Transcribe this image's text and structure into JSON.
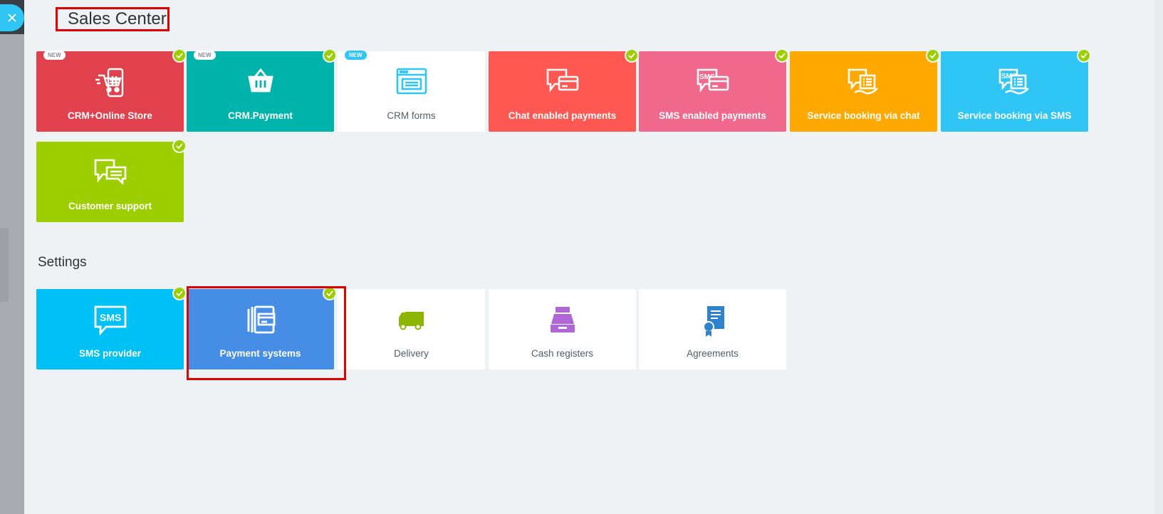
{
  "header": {
    "title": "Sales Center"
  },
  "close_button": {
    "icon": "close-icon"
  },
  "sales_tiles": [
    {
      "label": "CRM+Online Store",
      "color": "#e0414c",
      "badge": "NEW",
      "checked": true,
      "icon": "cart-phone-icon"
    },
    {
      "label": "CRM.Payment",
      "color": "#00b4ac",
      "badge": "NEW",
      "checked": true,
      "icon": "basket-icon"
    },
    {
      "label": "CRM forms",
      "color": "#ffffff",
      "badge": "NEW",
      "checked": false,
      "icon": "form-window-icon"
    },
    {
      "label": "Chat enabled payments",
      "color": "#ff5752",
      "checked": true,
      "icon": "chat-card-icon"
    },
    {
      "label": "SMS enabled payments",
      "color": "#f0688c",
      "checked": true,
      "icon": "sms-card-icon"
    },
    {
      "label": "Service booking via chat",
      "color": "#ffa900",
      "checked": true,
      "icon": "chat-booking-icon"
    },
    {
      "label": "Service booking via SMS",
      "color": "#2fc6f6",
      "checked": true,
      "icon": "sms-booking-icon"
    },
    {
      "label": "Customer support",
      "color": "#9dcf00",
      "checked": true,
      "icon": "chat-support-icon"
    }
  ],
  "settings": {
    "title": "Settings",
    "tiles": [
      {
        "label": "SMS provider",
        "color": "#00c1f6",
        "checked": true,
        "icon": "sms-icon"
      },
      {
        "label": "Payment systems",
        "color": "#468ee5",
        "checked": true,
        "icon": "payment-cards-icon"
      },
      {
        "label": "Delivery",
        "color": "#ffffff",
        "checked": false,
        "icon": "truck-icon"
      },
      {
        "label": "Cash registers",
        "color": "#ffffff",
        "checked": false,
        "icon": "cash-register-icon"
      },
      {
        "label": "Agreements",
        "color": "#ffffff",
        "checked": false,
        "icon": "agreement-icon"
      }
    ]
  }
}
